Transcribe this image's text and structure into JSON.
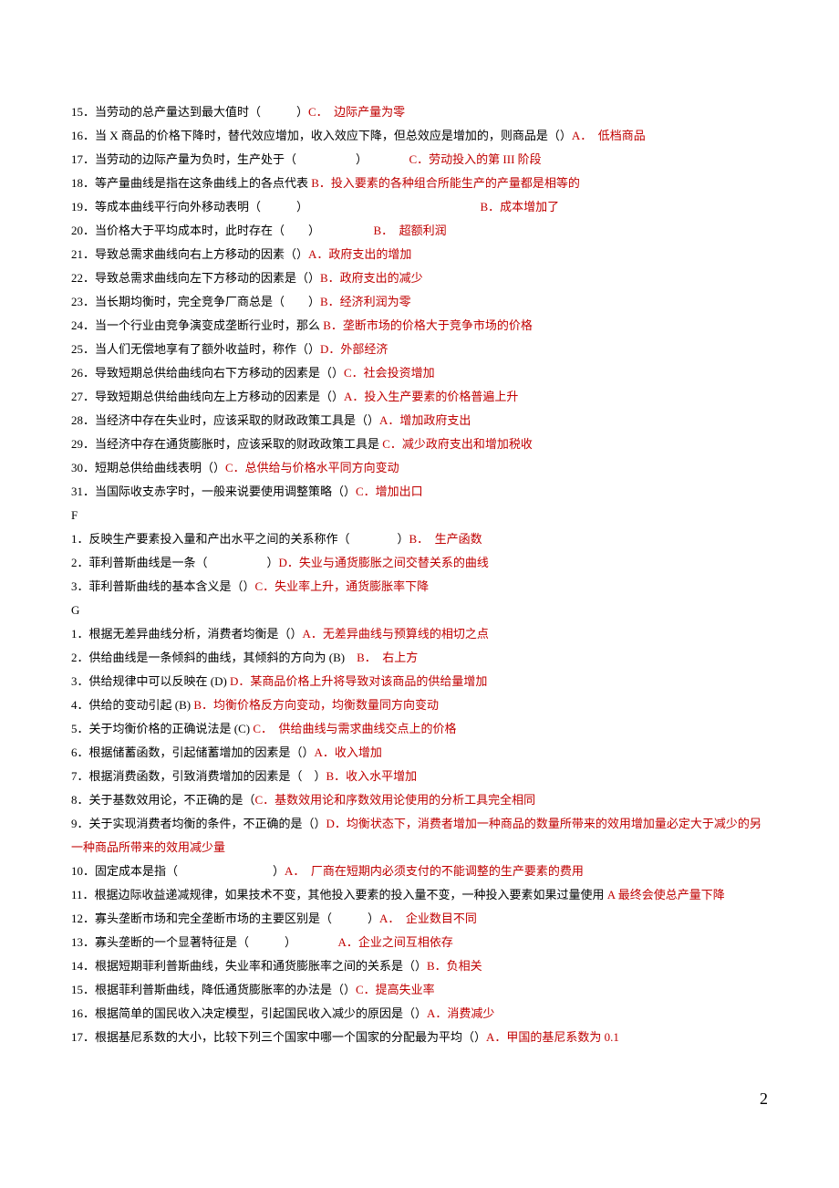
{
  "items": [
    {
      "q": "15．当劳动的总产量达到最大值时（　　　）",
      "a": "C．　边际产量为零"
    },
    {
      "q": "16．当 X 商品的价格下降时，替代效应增加，收入效应下降，但总效应是增加的，则商品是（）",
      "a": "A．　低档商品"
    },
    {
      "q": "17．当劳动的边际产量为负时，生产处于（　　　　　）　　　　",
      "a": "C．劳动投入的第 III 阶段"
    },
    {
      "q": "18．等产量曲线是指在这条曲线上的各点代表 ",
      "a": "B．投入要素的各种组合所能生产的产量都是相等的"
    },
    {
      "q": "19．等成本曲线平行向外移动表明（　　　）　　　　　　　　　　　　　　　",
      "a": "B．成本增加了"
    },
    {
      "q": "20．当价格大于平均成本时，此时存在（　　）　　　　　",
      "a": "B．　超额利润"
    },
    {
      "q": "21．导致总需求曲线向右上方移动的因素（）",
      "a": "A．政府支出的增加"
    },
    {
      "q": "22．导致总需求曲线向左下方移动的因素是（）",
      "a": "B．政府支出的减少"
    },
    {
      "q": "23．当长期均衡时，完全竞争厂商总是（　　）",
      "a": "B．经济利润为零"
    },
    {
      "q": "24．当一个行业由竞争演变成垄断行业时，那么 ",
      "a": "B．垄断市场的价格大于竞争市场的价格"
    },
    {
      "q": "25．当人们无偿地享有了额外收益时，称作（）",
      "a": "D．外部经济"
    },
    {
      "q": "26．导致短期总供给曲线向右下方移动的因素是（）",
      "a": "C．社会投资增加"
    },
    {
      "q": "27．导致短期总供给曲线向左上方移动的因素是（）",
      "a": "A．投入生产要素的价格普遍上升"
    },
    {
      "q": "28．当经济中存在失业时，应该采取的财政政策工具是（）",
      "a": "A．增加政府支出"
    },
    {
      "q": "29．当经济中存在通货膨胀时，应该采取的财政政策工具是 ",
      "a": "C．减少政府支出和增加税收"
    },
    {
      "q": "30．短期总供给曲线表明（）",
      "a": "C．总供给与价格水平同方向变动"
    },
    {
      "q": "31．当国际收支赤字时，一般来说要使用调整策略（）",
      "a": "C．增加出口"
    }
  ],
  "section_f": "F",
  "f_items": [
    {
      "q": "1．反映生产要素投入量和产出水平之间的关系称作（　　　　）",
      "a": "B．　生产函数"
    },
    {
      "q": "2．菲利普斯曲线是一条（　　　　　）",
      "a": "D．失业与通货膨胀之间交替关系的曲线"
    },
    {
      "q": "3．菲利普斯曲线的基本含义是（）",
      "a": "C．失业率上升，通货膨胀率下降"
    }
  ],
  "section_g": "G",
  "g_items": [
    {
      "q": "1．根据无差异曲线分析，消费者均衡是（）",
      "a": "A．无差异曲线与预算线的相切之点"
    },
    {
      "q": "2．供给曲线是一条倾斜的曲线，其倾斜的方向为 (B)　",
      "a": "B．　右上方"
    },
    {
      "q": "3．供给规律中可以反映在 (D) ",
      "a": "D．某商品价格上升将导致对该商品的供给量增加"
    },
    {
      "q": "4．供给的变动引起 (B) ",
      "a": "B．均衡价格反方向变动，均衡数量同方向变动"
    },
    {
      "q": "5．关于均衡价格的正确说法是 (C) ",
      "a": "C．　供给曲线与需求曲线交点上的价格"
    },
    {
      "q": "6．根据储蓄函数，引起储蓄增加的因素是（）",
      "a": "A．收入增加"
    },
    {
      "q": "7．根据消费函数，引致消费增加的因素是（　）",
      "a": "B．收入水平增加"
    },
    {
      "q": "8．关于基数效用论，不正确的是（",
      "a": "C．基数效用论和序数效用论使用的分析工具完全相同"
    },
    {
      "q": "9．关于实现消费者均衡的条件，不正确的是（）",
      "a": "D．均衡状态下，消费者增加一种商品的数量所带来的效用增加量必定大于减少的另一种商品所带来的效用减少量"
    },
    {
      "q": "10．固定成本是指（　　　　　　　　）",
      "a": "A．　厂商在短期内必须支付的不能调整的生产要素的费用"
    },
    {
      "q": "11．根据边际收益递减规律，如果技术不变，其他投入要素的投入量不变，一种投入要素如果过量使用 ",
      "a": "A 最终会使总产量下降"
    },
    {
      "q": "12．寡头垄断市场和完全垄断市场的主要区别是（　　　）",
      "a": "A．　企业数目不同"
    },
    {
      "q": "13．寡头垄断的一个显著特征是（　　　）　　　　",
      "a": "A．企业之间互相依存"
    },
    {
      "q": "14．根据短期菲利普斯曲线，失业率和通货膨胀率之间的关系是（）",
      "a": "B．负相关"
    },
    {
      "q": "15．根据菲利普斯曲线，降低通货膨胀率的办法是（）",
      "a": "C．提高失业率"
    },
    {
      "q": "16．根据简单的国民收入决定模型，引起国民收入减少的原因是（）",
      "a": "A．消费减少"
    },
    {
      "q": "17．根据基尼系数的大小，比较下列三个国家中哪一个国家的分配最为平均（）",
      "a": "A．甲国的基尼系数为 0.1"
    }
  ],
  "page_number": "2"
}
